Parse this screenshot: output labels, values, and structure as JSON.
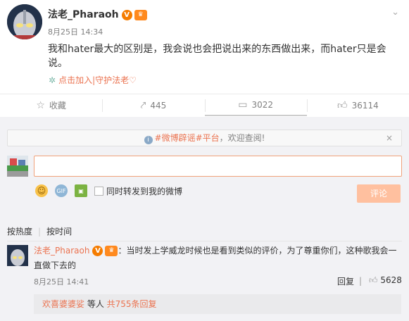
{
  "post": {
    "author": "法老_Pharaoh",
    "verified_badge": "V",
    "vip_badge": "♛",
    "timestamp": "8月25日 14:34",
    "text": "我和hater最大的区别是，我会说也会把说出来的东西做出来，而hater只是会说。",
    "join_link": "点击加入|守护法老♡",
    "menu_icon": "chevron-down-icon"
  },
  "actions": {
    "favorite": "收藏",
    "repost": "445",
    "comment": "3022",
    "like": "36114"
  },
  "notice": {
    "prefix": "",
    "link": "#微博辟谣#平台",
    "suffix": "，欢迎查阅!",
    "close": "×"
  },
  "composer": {
    "placeholder": "",
    "repost_checkbox_label": "同时转发到我的微博",
    "submit_label": "评论",
    "gif_label": "GIF"
  },
  "sort": {
    "by_hot": "按热度",
    "by_time": "按时间"
  },
  "comment": {
    "author": "法老_Pharaoh",
    "verified_badge": "V",
    "vip_badge": "♛",
    "text": "：当时发上学威龙时候也是看到类似的评价，为了尊重你们，这种歌我会一直做下去的",
    "timestamp": "8月25日 14:41",
    "reply_label": "回复",
    "like_count": "5628",
    "replies": {
      "user_link": "欢喜婆婆娑",
      "mid": " 等人 ",
      "count_link": "共755条回复"
    }
  },
  "colors": {
    "accent": "#eb7350",
    "input_border": "#f0a27b",
    "submit_disabled": "#ffc09f",
    "background": "#f2f2f5"
  }
}
